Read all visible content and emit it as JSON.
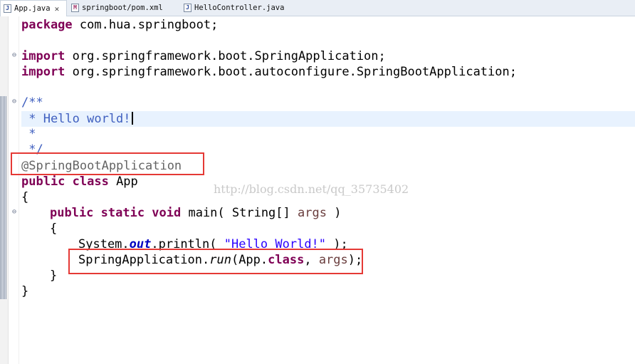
{
  "tabs": [
    {
      "label": "App.java",
      "icon": "java-file-icon",
      "active": true
    },
    {
      "label": "springboot/pom.xml",
      "icon": "maven-file-icon",
      "active": false
    },
    {
      "label": "HelloController.java",
      "icon": "java-file-icon",
      "active": false
    }
  ],
  "code": {
    "l1_kw": "package",
    "l1_rest": " com.hua.springboot;",
    "l2_kw": "import",
    "l2_rest": " org.springframework.boot.SpringApplication;",
    "l3_kw": "import",
    "l3_rest": " org.springframework.boot.autoconfigure.SpringBootApplication;",
    "l4": "/**",
    "l5": " * Hello world!",
    "l6": " *",
    "l7": " */",
    "l8": "@SpringBootApplication",
    "l9_kw": "public class",
    "l9_rest": " App",
    "l10": "{",
    "l11_kw": "public static void",
    "l11_mid": " main( String[] ",
    "l11_var": "args",
    "l11_end": " )",
    "l12": "{",
    "l13_a": "System.",
    "l13_field": "out",
    "l13_b": ".println( ",
    "l13_str": "\"Hello World!\"",
    "l13_c": " );",
    "l14_a": "SpringApplication.",
    "l14_method": "run",
    "l14_b": "(App.",
    "l14_kw": "class",
    "l14_c": ", ",
    "l14_var": "args",
    "l14_d": ");",
    "l15": "}",
    "l16": "}"
  },
  "watermark": "http://blog.csdn.net/qq_35735402",
  "colors": {
    "keyword": "#7f0055",
    "comment": "#3f5fbf",
    "annotation": "#646464",
    "string": "#2a00ff",
    "highlight_box": "#e53935"
  }
}
